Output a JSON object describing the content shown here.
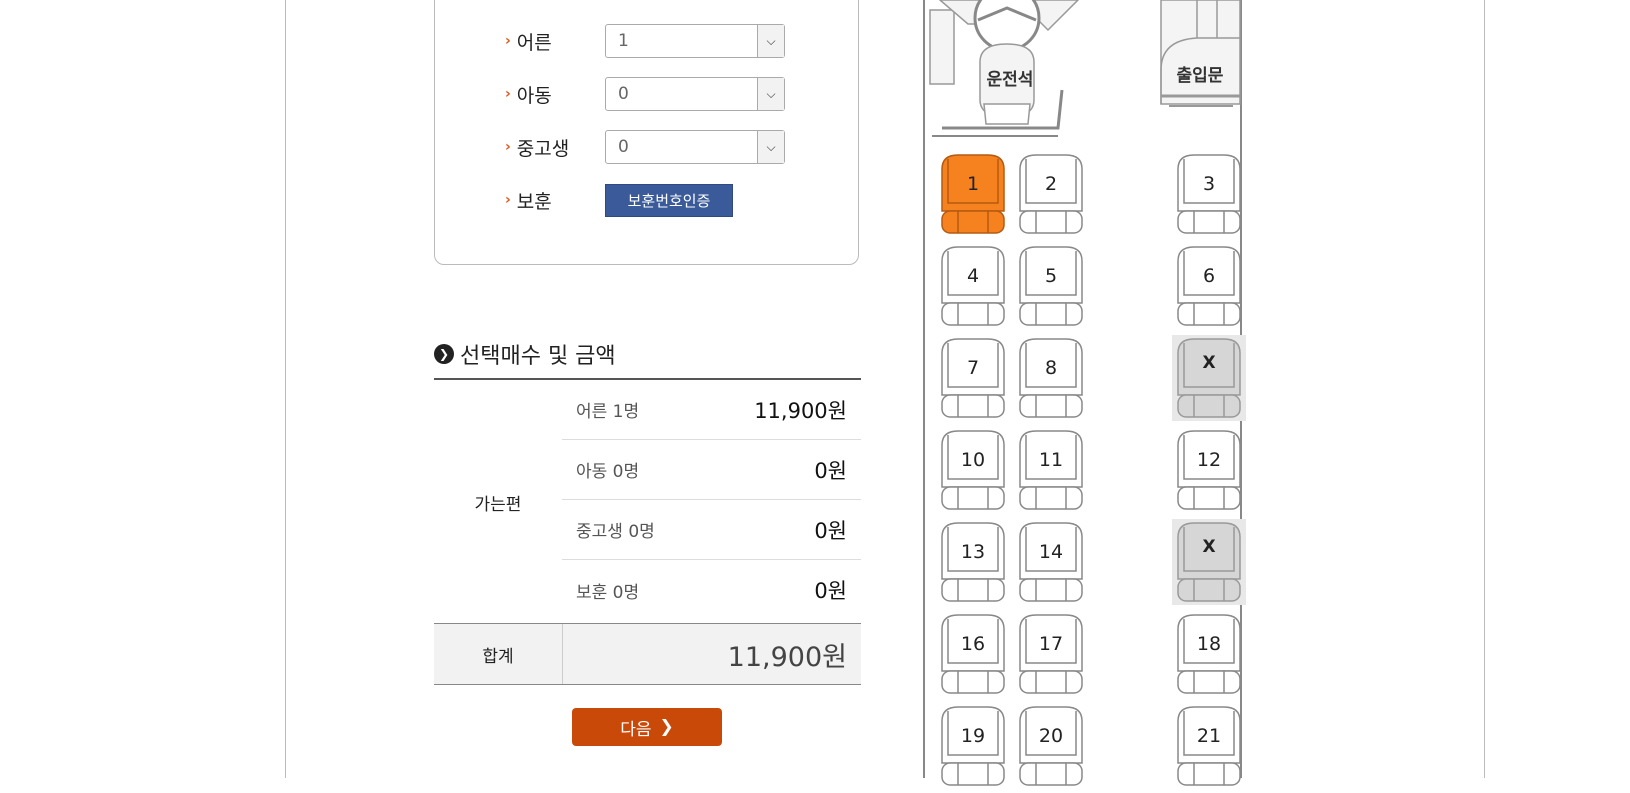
{
  "passengers": [
    {
      "label": "어른",
      "value": "1"
    },
    {
      "label": "아동",
      "value": "0"
    },
    {
      "label": "중고생",
      "value": "0"
    }
  ],
  "veteran": {
    "label": "보훈",
    "button": "보훈번호인증"
  },
  "summary": {
    "title": "선택매수 및 금액",
    "group": "가는편",
    "rows": [
      {
        "label": "어른 1명",
        "amount": "11,900원"
      },
      {
        "label": "아동 0명",
        "amount": "0원"
      },
      {
        "label": "중고생 0명",
        "amount": "0원"
      },
      {
        "label": "보훈 0명",
        "amount": "0원"
      }
    ],
    "total_label": "합계",
    "total_amount": "11,900원"
  },
  "next_button": "다음",
  "bus": {
    "driver_label": "운전석",
    "door_label": "출입문",
    "seats": [
      {
        "label": "1",
        "state": "selected"
      },
      {
        "label": "2",
        "state": "available"
      },
      {
        "label": "3",
        "state": "available"
      },
      {
        "label": "4",
        "state": "available"
      },
      {
        "label": "5",
        "state": "available"
      },
      {
        "label": "6",
        "state": "available"
      },
      {
        "label": "7",
        "state": "available"
      },
      {
        "label": "8",
        "state": "available"
      },
      {
        "label": "X",
        "state": "unavailable"
      },
      {
        "label": "10",
        "state": "available"
      },
      {
        "label": "11",
        "state": "available"
      },
      {
        "label": "12",
        "state": "available"
      },
      {
        "label": "13",
        "state": "available"
      },
      {
        "label": "14",
        "state": "available"
      },
      {
        "label": "X",
        "state": "unavailable"
      },
      {
        "label": "16",
        "state": "available"
      },
      {
        "label": "17",
        "state": "available"
      },
      {
        "label": "18",
        "state": "available"
      },
      {
        "label": "19",
        "state": "available"
      },
      {
        "label": "20",
        "state": "available"
      },
      {
        "label": "21",
        "state": "available"
      }
    ]
  },
  "colors": {
    "selected": "#f5821f",
    "unavailable": "#d6d6d6",
    "accent": "#c94a08",
    "auth": "#3a5a9a"
  }
}
